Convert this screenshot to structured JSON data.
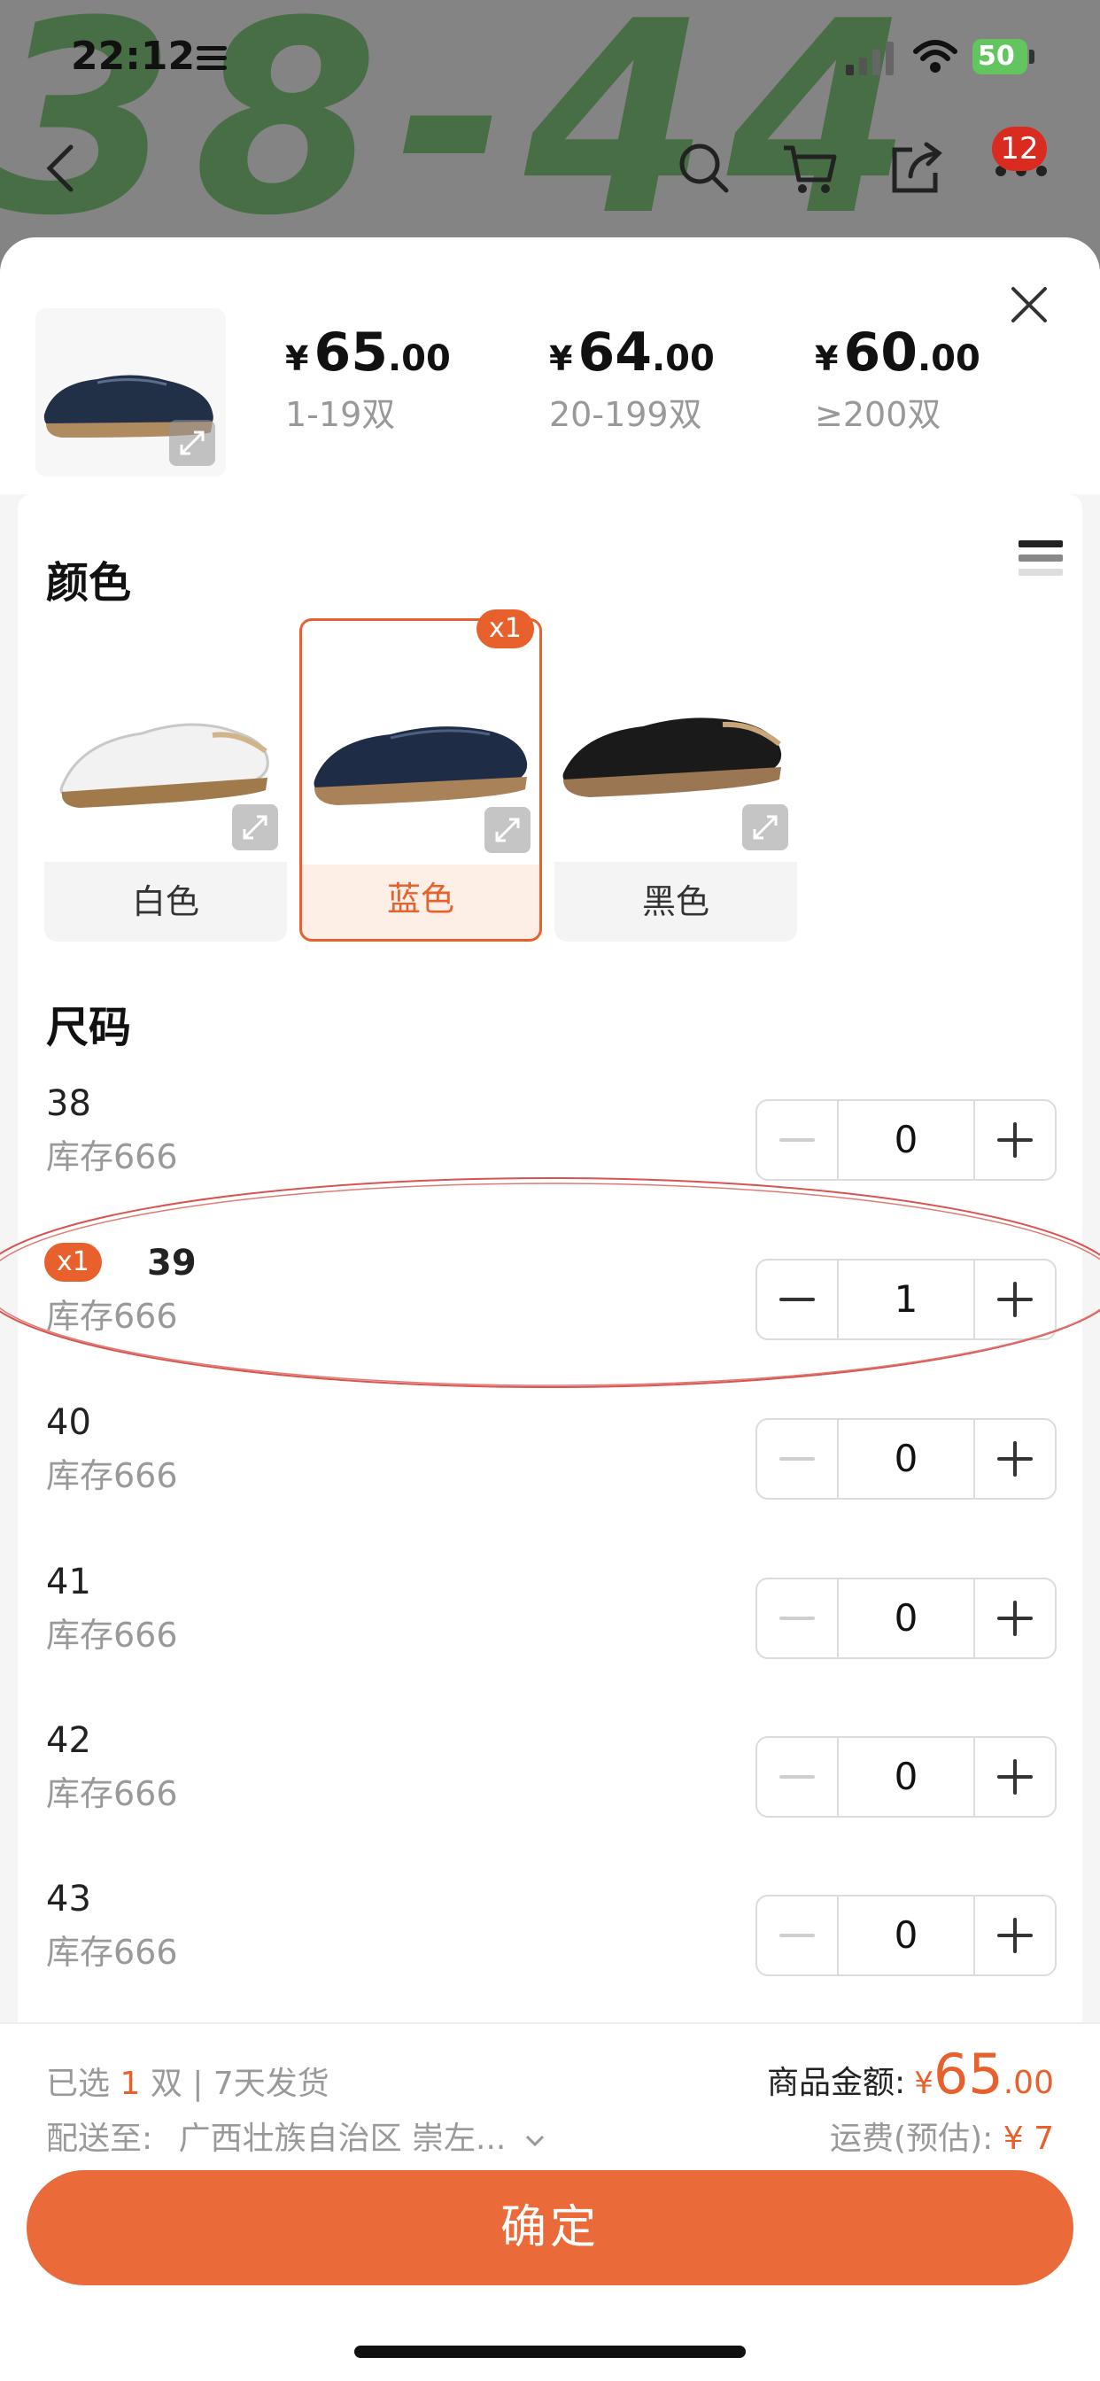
{
  "status_bar": {
    "time": "22:12",
    "battery": "50"
  },
  "background": {
    "big_text": "38-44",
    "cart_badge": "12"
  },
  "header": {
    "price_tiers": [
      {
        "currency": "¥",
        "integer": "65",
        "decimal": ".00",
        "range": "1-19双"
      },
      {
        "currency": "¥",
        "integer": "64",
        "decimal": ".00",
        "range": "20-199双"
      },
      {
        "currency": "¥",
        "integer": "60",
        "decimal": ".00",
        "range": "≥200双"
      }
    ]
  },
  "color_section": {
    "title": "颜色",
    "options": [
      {
        "label": "白色",
        "selected": false,
        "badge": ""
      },
      {
        "label": "蓝色",
        "selected": true,
        "badge": "x1"
      },
      {
        "label": "黑色",
        "selected": false,
        "badge": ""
      }
    ]
  },
  "size_section": {
    "title": "尺码",
    "rows": [
      {
        "size": "38",
        "stock": "库存666",
        "qty": "0",
        "badge": ""
      },
      {
        "size": "39",
        "stock": "库存666",
        "qty": "1",
        "badge": "x1"
      },
      {
        "size": "40",
        "stock": "库存666",
        "qty": "0",
        "badge": ""
      },
      {
        "size": "41",
        "stock": "库存666",
        "qty": "0",
        "badge": ""
      },
      {
        "size": "42",
        "stock": "库存666",
        "qty": "0",
        "badge": ""
      },
      {
        "size": "43",
        "stock": "库存666",
        "qty": "0",
        "badge": ""
      }
    ]
  },
  "footer": {
    "selected_prefix": "已选",
    "selected_count": "1",
    "selected_suffix": "双 | 7天发货",
    "ship_label": "配送至:",
    "ship_address": "广西壮族自治区 崇左...",
    "amount_label": "商品金额:",
    "amount_currency": "¥",
    "amount_int": "65",
    "amount_dec": ".00",
    "fee_label": "运费(预估):",
    "fee_value": "¥ 7",
    "confirm_label": "确定"
  },
  "colors": {
    "accent": "#e8612c",
    "confirm_bg": "#ea6a3a"
  },
  "icons": [
    "back-icon",
    "search-icon",
    "cart-icon",
    "share-icon",
    "more-icon",
    "close-icon",
    "expand-icon",
    "list-view-icon",
    "minus-icon",
    "plus-icon",
    "chevron-down-icon"
  ]
}
